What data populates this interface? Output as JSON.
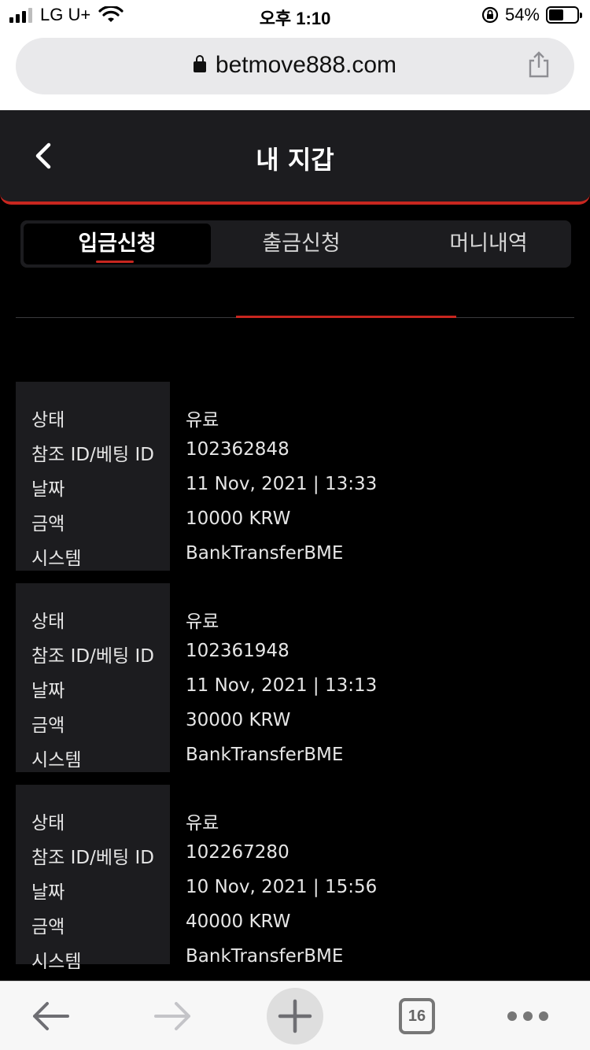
{
  "status_bar": {
    "carrier": "LG U+",
    "time": "오후 1:10",
    "battery": "54%",
    "battery_level": 0.54
  },
  "browser": {
    "url": "betmove888.com",
    "open_tabs": "16"
  },
  "header": {
    "title": "내 지갑"
  },
  "tabs": [
    {
      "label": "입금신청",
      "active": true
    },
    {
      "label": "출금신청",
      "active": false
    },
    {
      "label": "머니내역",
      "active": false
    }
  ],
  "records": [
    {
      "labels": {
        "status": "상태",
        "ref": "참조 ID/베팅 ID",
        "date": "날짜",
        "amount": "금액",
        "system": "시스템"
      },
      "status": "유료",
      "ref": "102362848",
      "date": "11 Nov, 2021 | 13:33",
      "amount": "10000 KRW",
      "system": "BankTransferBME"
    },
    {
      "labels": {
        "status": "상태",
        "ref": "참조 ID/베팅 ID",
        "date": "날짜",
        "amount": "금액",
        "system": "시스템"
      },
      "status": "유료",
      "ref": "102361948",
      "date": "11 Nov, 2021 | 13:13",
      "amount": "30000 KRW",
      "system": "BankTransferBME"
    },
    {
      "labels": {
        "status": "상태",
        "ref": "참조 ID/베팅 ID",
        "date": "날짜",
        "amount": "금액",
        "system": "시스템"
      },
      "status": "유료",
      "ref": "102267280",
      "date": "10 Nov, 2021 | 15:56",
      "amount": "40000 KRW",
      "system": "BankTransferBME"
    }
  ],
  "colors": {
    "accent": "#c8261f",
    "panel": "#1c1c1f",
    "background": "#000000"
  }
}
